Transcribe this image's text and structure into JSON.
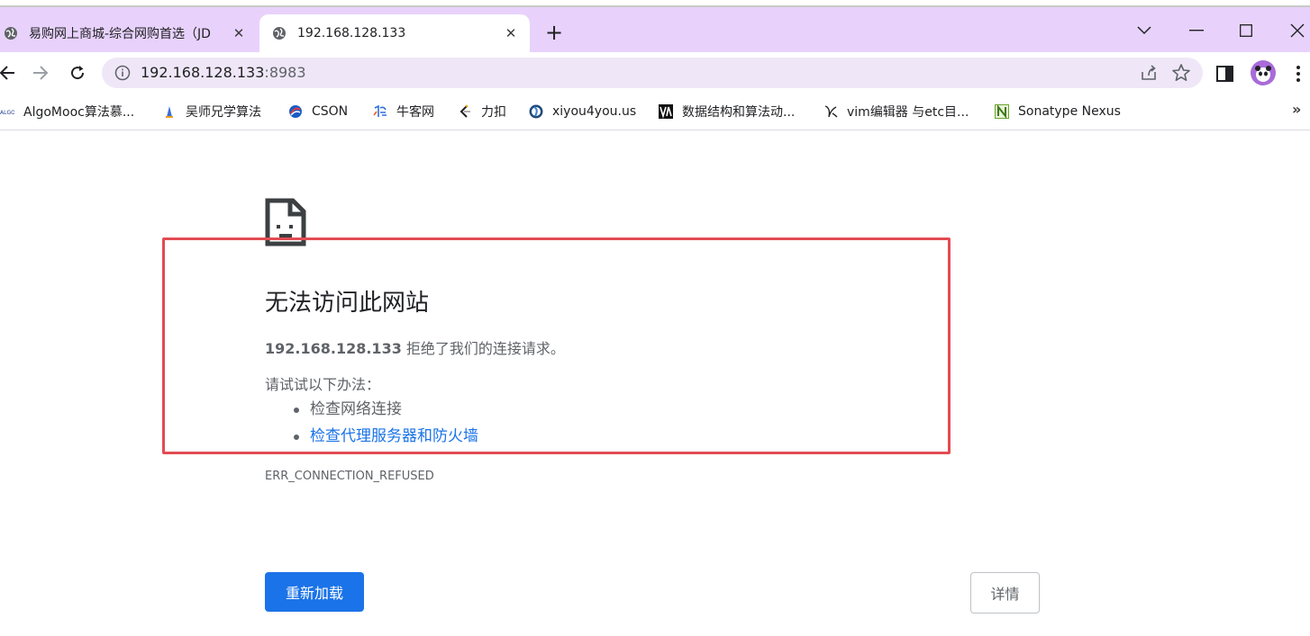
{
  "tabs": [
    {
      "title": "易购网上商城-综合网购首选（JD",
      "active": false
    },
    {
      "title": "192.168.128.133",
      "active": true
    }
  ],
  "omnibox": {
    "host": "192.168.128.133",
    "port": ":8983"
  },
  "bookmarks": [
    {
      "label": "AlgoMooc算法慕...",
      "icon": "algomooc-icon"
    },
    {
      "label": "吴师兄学算法",
      "icon": "wushixiong-icon"
    },
    {
      "label": "CSON",
      "icon": "cson-icon"
    },
    {
      "label": "牛客网",
      "icon": "nowcoder-icon"
    },
    {
      "label": "力扣",
      "icon": "leetcode-icon"
    },
    {
      "label": "xiyou4you.us",
      "icon": "globe-icon"
    },
    {
      "label": "数据结构和算法动...",
      "icon": "visualgo-icon"
    },
    {
      "label": "vim编辑器 与etc目...",
      "icon": "vim-icon"
    },
    {
      "label": "Sonatype Nexus",
      "icon": "nexus-icon"
    }
  ],
  "error": {
    "heading": "无法访问此网站",
    "host": "192.168.128.133",
    "message_suffix": " 拒绝了我们的连接请求。",
    "try_label": "请试试以下办法：",
    "suggestions": [
      "检查网络连接",
      "检查代理服务器和防火墙"
    ],
    "code": "ERR_CONNECTION_REFUSED",
    "reload_label": "重新加载",
    "details_label": "详情"
  },
  "colors": {
    "tabstrip": "#e8d2fc",
    "accent": "#1a73e8",
    "highlight_border": "#e34b53"
  }
}
